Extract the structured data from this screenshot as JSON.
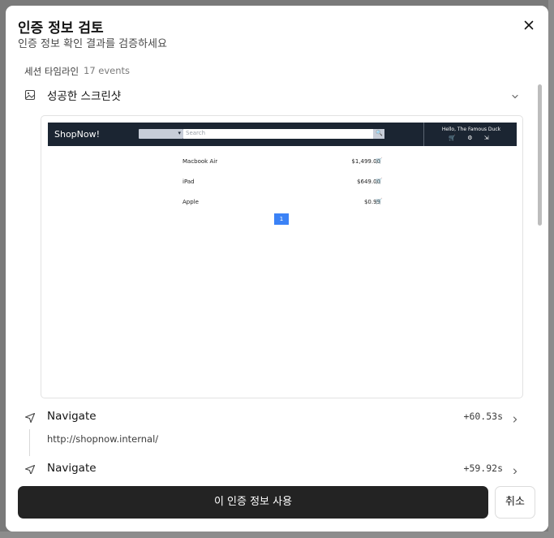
{
  "dialog": {
    "title": "인증 정보 검토",
    "subtitle": "인증 정보 확인 결과를 검증하세요"
  },
  "timeline": {
    "header": "세션 타임라인",
    "count": "17 events",
    "events": [
      {
        "icon": "image-icon",
        "title": "성공한 스크린샷",
        "expanded": true
      },
      {
        "icon": "navigate-icon",
        "title": "Navigate",
        "time": "+60.53s",
        "url": "http://shopnow.internal/"
      },
      {
        "icon": "navigate-icon",
        "title": "Navigate",
        "time": "+59.92s"
      }
    ]
  },
  "screenshot": {
    "logo": "ShopNow!",
    "search_placeholder": "Search",
    "search_button": "🔍",
    "greeting": "Hello, The Famous Duck",
    "nav_icons": "🛒 ⚙ ⇲",
    "products": [
      {
        "name": "Macbook Air",
        "price": "$1,499.00",
        "cart": "🛒"
      },
      {
        "name": "iPad",
        "price": "$649.00",
        "cart": "🛒"
      },
      {
        "name": "Apple",
        "price": "$0.99",
        "cart": "🛒"
      }
    ],
    "page": "1"
  },
  "footer": {
    "primary_label": "이 인증 정보 사용",
    "cancel_label": "취소"
  }
}
